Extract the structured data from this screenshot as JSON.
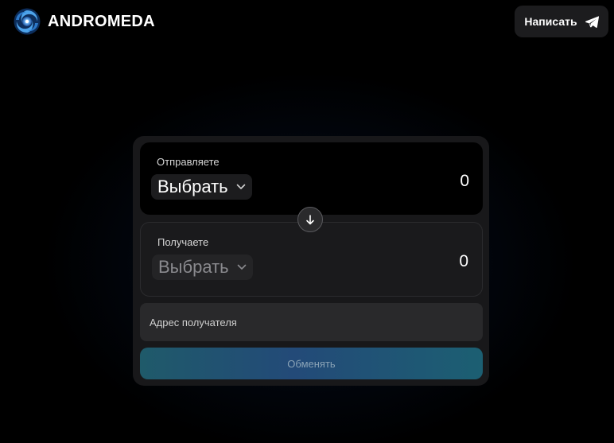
{
  "header": {
    "brand_name": "ANDROMEDA",
    "write_button_label": "Написать"
  },
  "swap": {
    "send": {
      "label": "Отправляете",
      "token_select": "Выбрать",
      "amount": "0"
    },
    "receive": {
      "label": "Получаете",
      "token_select": "Выбрать",
      "amount": "0"
    },
    "recipient_address_placeholder": "Адрес получателя",
    "exchange_button_label": "Обменять"
  },
  "colors": {
    "accent_gradient_start": "#1f5a6a",
    "accent_gradient_mid": "#234a78",
    "card_background": "#18181a",
    "logo_blue": "#3a8fd6"
  },
  "icons": {
    "logo": "galaxy-logo-icon",
    "write_button": "telegram-icon",
    "select_chevron": "chevron-down-icon",
    "swap_direction": "arrow-down-icon"
  }
}
